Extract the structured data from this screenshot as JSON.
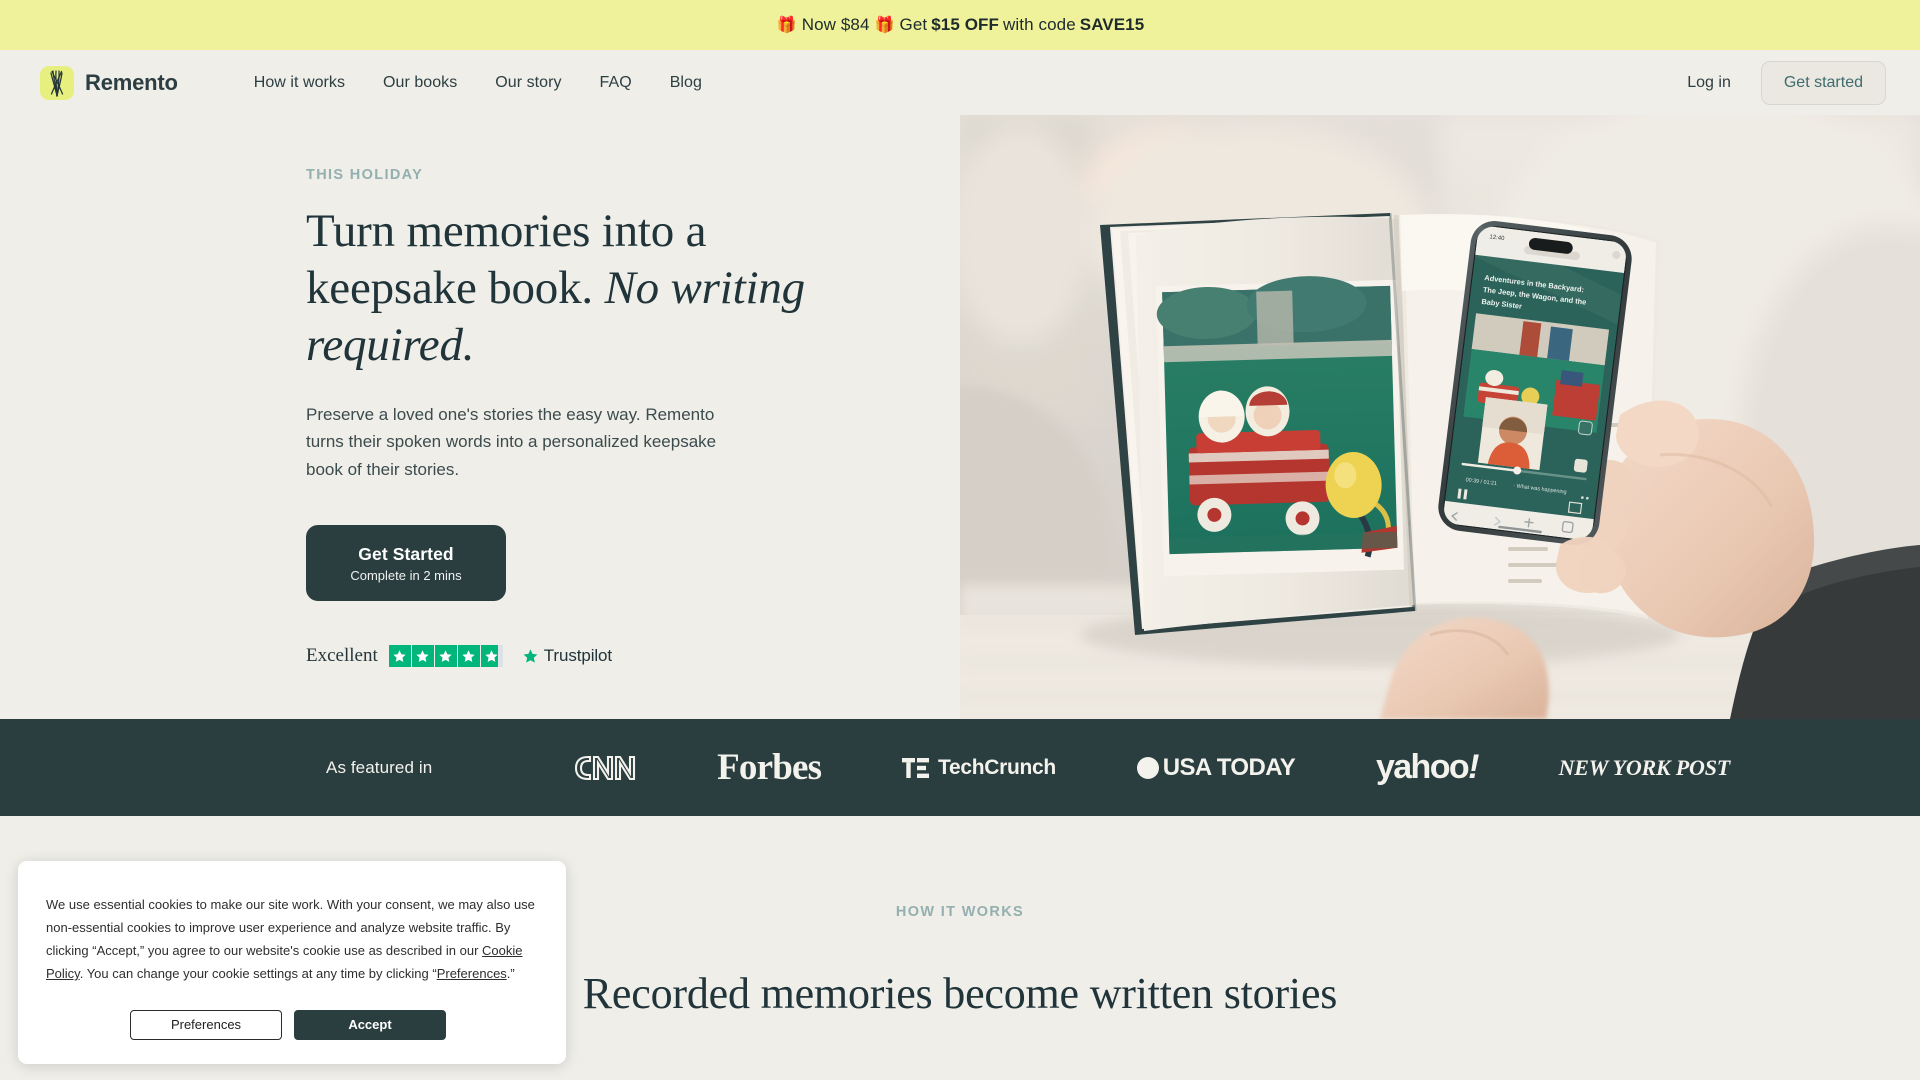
{
  "announcement": {
    "gift_icon": "gift-icon",
    "price_text": "Now $84",
    "offer_prefix": "Get",
    "offer_amount": "$15 OFF",
    "offer_middle": "with code",
    "offer_code": "SAVE15"
  },
  "header": {
    "logo_icon": "remento-wheat-logo-icon",
    "brand": "Remento",
    "nav": [
      {
        "label": "How it works"
      },
      {
        "label": "Our books"
      },
      {
        "label": "Our story"
      },
      {
        "label": "FAQ"
      },
      {
        "label": "Blog"
      }
    ],
    "login_label": "Log in",
    "get_started_label": "Get started"
  },
  "hero": {
    "eyebrow": "THIS HOLIDAY",
    "title_line1": "Turn memories into a keepsake",
    "title_line2_plain": "book.",
    "title_line2_italic": "No writing required.",
    "subtitle": "Preserve a loved one's stories the easy way. Remento turns their spoken words into a personalized keepsake book of their stories.",
    "cta_primary": "Get Started",
    "cta_secondary": "Complete in 2 mins",
    "trustpilot": {
      "rating_word": "Excellent",
      "stars": 4.8,
      "star_count": 5,
      "brand": "Trustpilot",
      "star_color": "#00B67A"
    },
    "image": {
      "alt": "hero-photo-hands-holding-phone-over-keepsake-book",
      "phone_story_title": "Adventures in the Backyard: The Jeep, the Wagon, and the Baby Sister",
      "phone_status_time": "12:40",
      "phone_player_time": "00:39 / 01:21",
      "phone_prompt": "What was happening"
    }
  },
  "press": {
    "label": "As featured in",
    "logos": [
      {
        "name": "CNN",
        "icon": "cnn-logo-icon"
      },
      {
        "name": "Forbes",
        "icon": "forbes-logo-icon"
      },
      {
        "name": "TechCrunch",
        "icon": "techcrunch-logo-icon"
      },
      {
        "name": "USA TODAY",
        "icon": "usatoday-logo-icon"
      },
      {
        "name": "yahoo!",
        "icon": "yahoo-logo-icon"
      },
      {
        "name": "NEW YORK POST",
        "icon": "nypost-logo-icon"
      }
    ]
  },
  "how_it_works": {
    "eyebrow": "HOW IT WORKS",
    "heading": "Recorded memories become written stories"
  },
  "cookie_banner": {
    "text_1": "We use essential cookies to make our site work. With your consent, we may also use non-essential cookies to improve user experience and analyze website traffic. By clicking “Accept,” you agree to our website's cookie use as described in our ",
    "link_policy": "Cookie Policy",
    "text_2": ". You can change your cookie settings at any time by clicking “",
    "link_prefs": "Preferences",
    "text_3": ".”",
    "preferences_label": "Preferences",
    "accept_label": "Accept"
  },
  "colors": {
    "announce_bg": "#EFF29A",
    "page_bg": "#EFEEE9",
    "dark_teal": "#2A3D3F",
    "eyebrow_teal": "#93AFAF",
    "accent_green": "#00B67A",
    "logo_green": "#E7F07E"
  }
}
